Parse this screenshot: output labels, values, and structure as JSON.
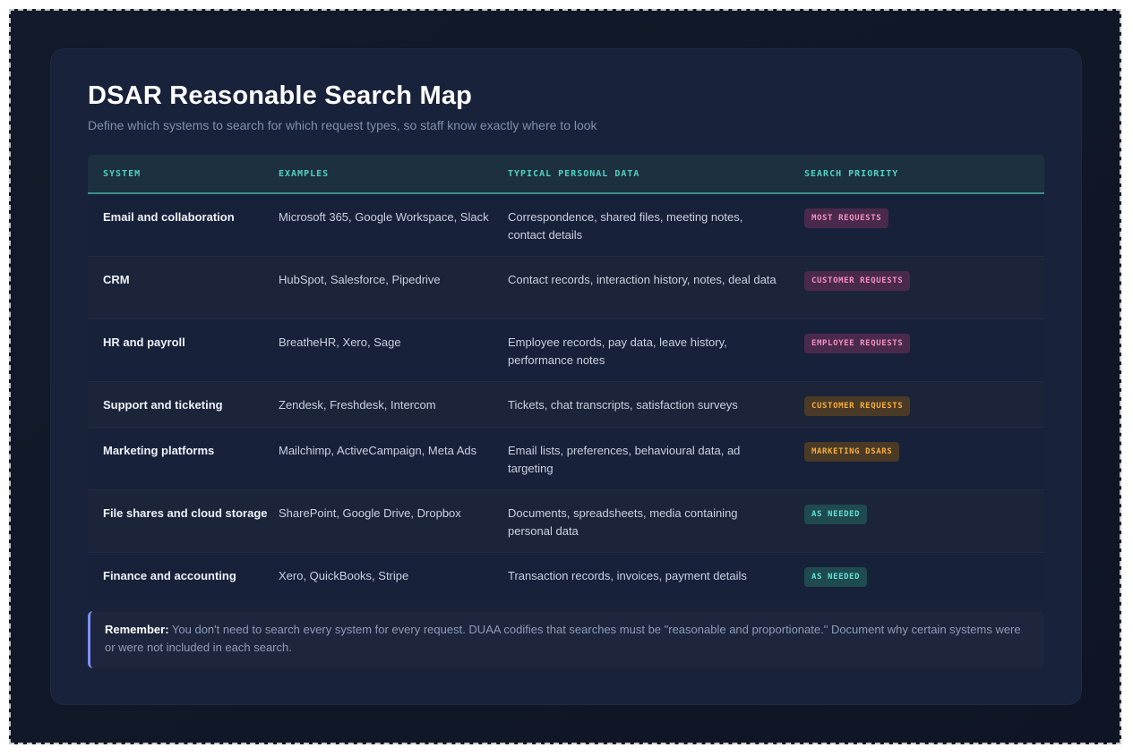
{
  "title": "DSAR Reasonable Search Map",
  "subtitle": "Define which systems to search for which request types, so staff know exactly where to look",
  "table": {
    "headers": [
      "SYSTEM",
      "EXAMPLES",
      "TYPICAL PERSONAL DATA",
      "SEARCH PRIORITY"
    ],
    "rows": [
      {
        "system": "Email and collaboration",
        "examples": "Microsoft 365, Google Workspace, Slack",
        "data": "Correspondence, shared files, meeting notes, contact details",
        "priority": "MOST REQUESTS",
        "priority_color": "#f48fc3"
      },
      {
        "system": "CRM",
        "examples": "HubSpot, Salesforce, Pipedrive",
        "data": "Contact records, interaction history, notes, deal data",
        "priority": "CUSTOMER REQUESTS",
        "priority_color": "#f48fc3"
      },
      {
        "system": "HR and payroll",
        "examples": "BreatheHR, Xero, Sage",
        "data": "Employee records, pay data, leave history, performance notes",
        "priority": "EMPLOYEE REQUESTS",
        "priority_color": "#f48fc3"
      },
      {
        "system": "Support and ticketing",
        "examples": "Zendesk, Freshdesk, Intercom",
        "data": "Tickets, chat transcripts, satisfaction surveys",
        "priority": "CUSTOMER REQUESTS",
        "priority_color": "#f6ad3b"
      },
      {
        "system": "Marketing platforms",
        "examples": "Mailchimp, ActiveCampaign, Meta Ads",
        "data": "Email lists, preferences, behavioural data, ad targeting",
        "priority": "MARKETING DSARS",
        "priority_color": "#f6ad3b"
      },
      {
        "system": "File shares and cloud storage",
        "examples": "SharePoint, Google Drive, Dropbox",
        "data": "Documents, spreadsheets, media containing personal data",
        "priority": "AS NEEDED",
        "priority_color": "#63e0d3"
      },
      {
        "system": "Finance and accounting",
        "examples": "Xero, QuickBooks, Stripe",
        "data": "Transaction records, invoices, payment details",
        "priority": "AS NEEDED",
        "priority_color": "#63e0d3"
      }
    ]
  },
  "note": {
    "label": "Remember:",
    "text": " You don't need to search every system for every request. DUAA codifies that searches must be \"reasonable and proportionate.\" Document why certain systems were or were not included in each search."
  }
}
